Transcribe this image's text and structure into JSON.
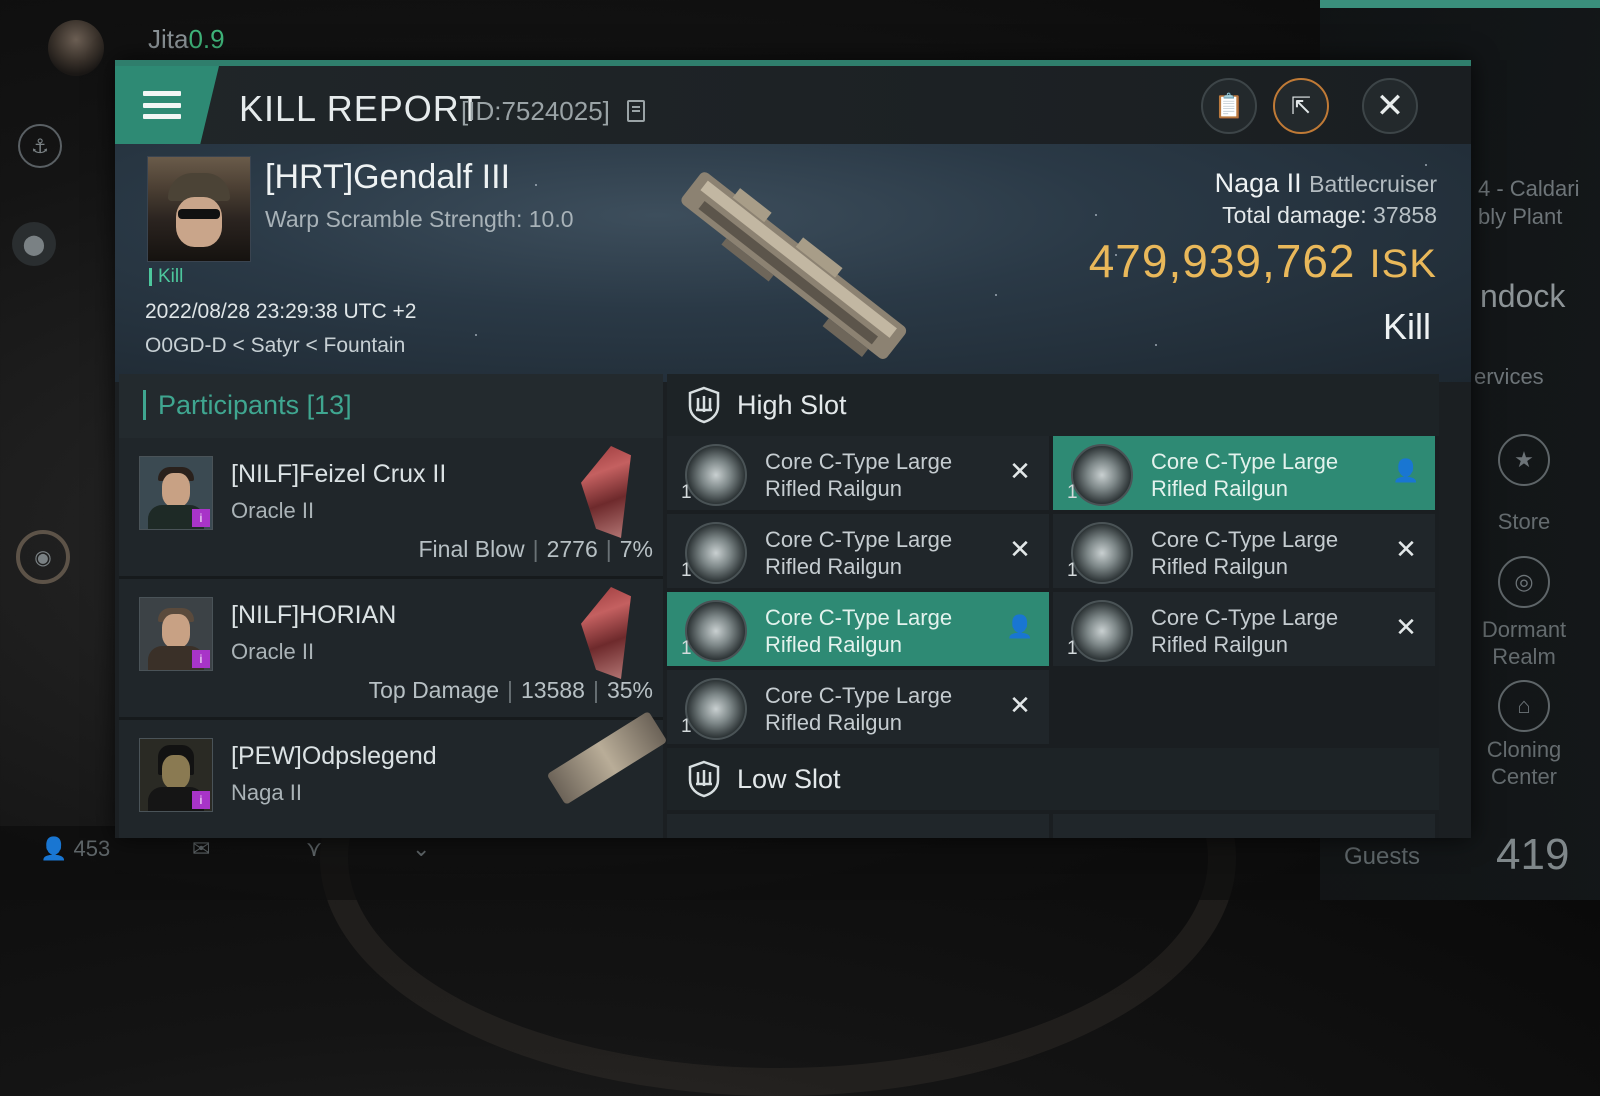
{
  "background": {
    "system": "Jita",
    "security": "0.9",
    "bottom_bar": {
      "pilots_online": "453"
    },
    "right_panel": {
      "fragment_1": "4 - Caldari",
      "fragment_2": "bly Plant",
      "undock_fragment": "ndock",
      "services_fragment": "ervices",
      "store_label": "Store",
      "dormant_realm_label": "Dormant Realm",
      "cloning_center_label": "Cloning Center",
      "guests_label": "Guests",
      "guests_count": "419"
    }
  },
  "window": {
    "title": "KILL REPORT",
    "id_label": "[ID:7524025]",
    "victim": {
      "name": "[HRT]Gendalf III",
      "subtitle": "Warp Scramble Strength: 10.0",
      "tag": "Kill",
      "time": "2022/08/28 23:29:38 UTC +2",
      "location": "O0GD-D < Satyr < Fountain",
      "ship": "Naga II",
      "ship_class": "Battlecruiser",
      "total_damage_label": "Total damage:",
      "total_damage": "37858",
      "isk_value": "479,939,762",
      "isk_unit": "ISK",
      "result": "Kill"
    },
    "participants": {
      "header": "Participants [13]",
      "rows": [
        {
          "name": "[NILF]Feizel Crux II",
          "ship": "Oracle II",
          "role": "Final Blow",
          "damage": "2776",
          "percent": "7%"
        },
        {
          "name": "[NILF]HORIAN",
          "ship": "Oracle II",
          "role": "Top Damage",
          "damage": "13588",
          "percent": "35%"
        },
        {
          "name": "[PEW]Odpslegend",
          "ship": "Naga II",
          "role": "",
          "damage": "",
          "percent": ""
        }
      ]
    },
    "fitting": {
      "high_slot_label": "High Slot",
      "low_slot_label": "Low Slot",
      "high_slot": [
        {
          "name": "Core C-Type Large Rifled Railgun",
          "qty": "1",
          "state": "destroyed"
        },
        {
          "name": "Core C-Type Large Rifled Railgun",
          "qty": "1",
          "state": "dropped"
        },
        {
          "name": "Core C-Type Large Rifled Railgun",
          "qty": "1",
          "state": "destroyed"
        },
        {
          "name": "Core C-Type Large Rifled Railgun",
          "qty": "1",
          "state": "destroyed"
        },
        {
          "name": "Core C-Type Large Rifled Railgun",
          "qty": "1",
          "state": "dropped"
        },
        {
          "name": "Core C-Type Large Rifled Railgun",
          "qty": "1",
          "state": "destroyed"
        },
        {
          "name": "Core C-Type Large Rifled Railgun",
          "qty": "1",
          "state": "destroyed"
        }
      ]
    }
  },
  "colors": {
    "accent": "#2e8a74",
    "isk": "#e9b85a",
    "kill_tag": "#4dc79d",
    "security": "#3fb57a"
  }
}
